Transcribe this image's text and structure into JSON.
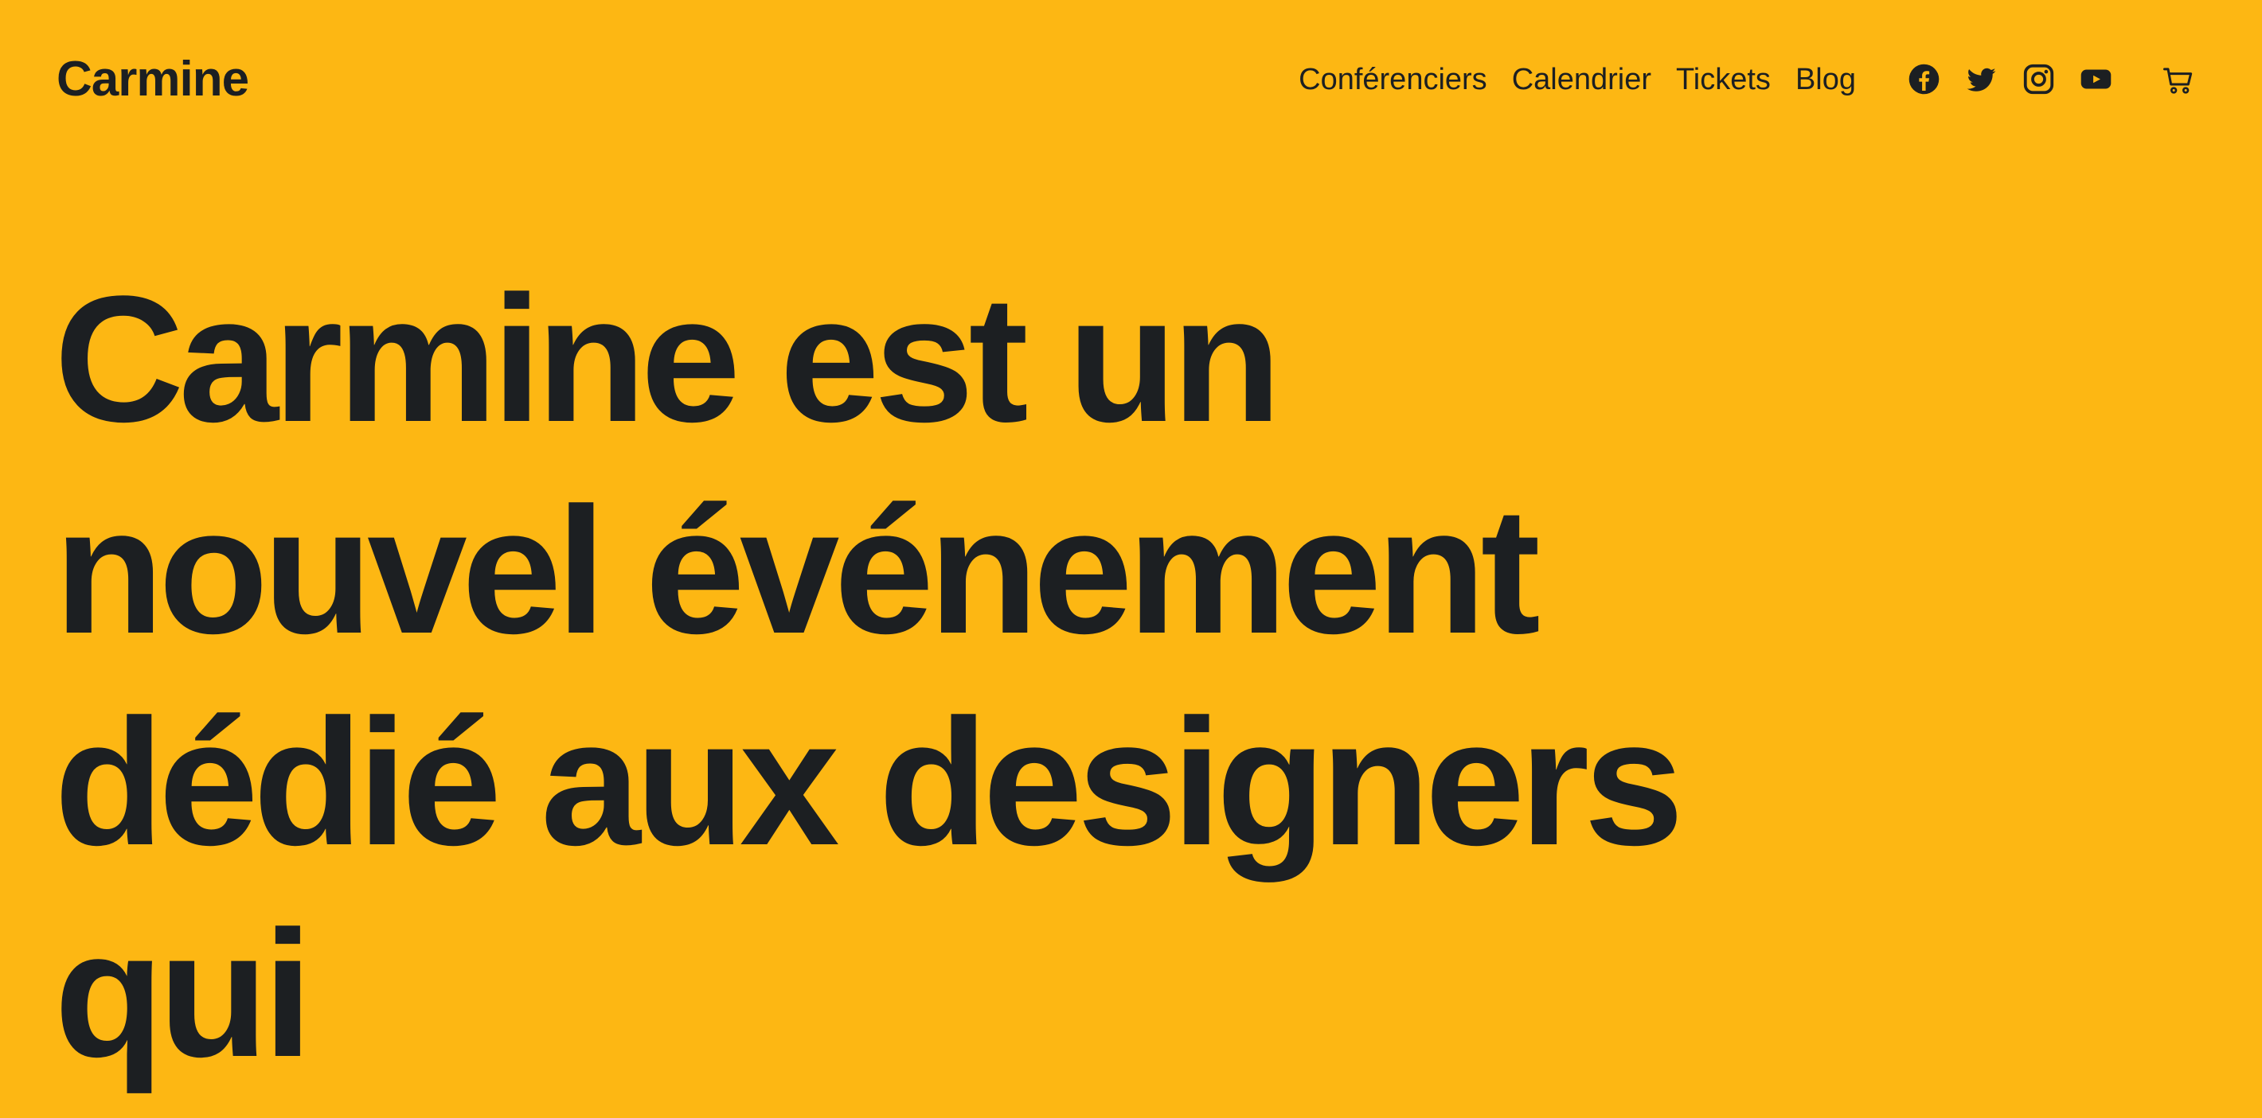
{
  "header": {
    "logo": "Carmine",
    "nav": {
      "speakers": "Conférenciers",
      "calendar": "Calendrier",
      "tickets": "Tickets",
      "blog": "Blog"
    },
    "social_icons": [
      "facebook-icon",
      "twitter-icon",
      "instagram-icon",
      "youtube-icon"
    ],
    "cart_icon": "cart-icon"
  },
  "hero": {
    "headline": "Carmine est un nouvel événement dédié aux designers qui"
  },
  "colors": {
    "background": "#FDB713",
    "text": "#1C1F22"
  }
}
